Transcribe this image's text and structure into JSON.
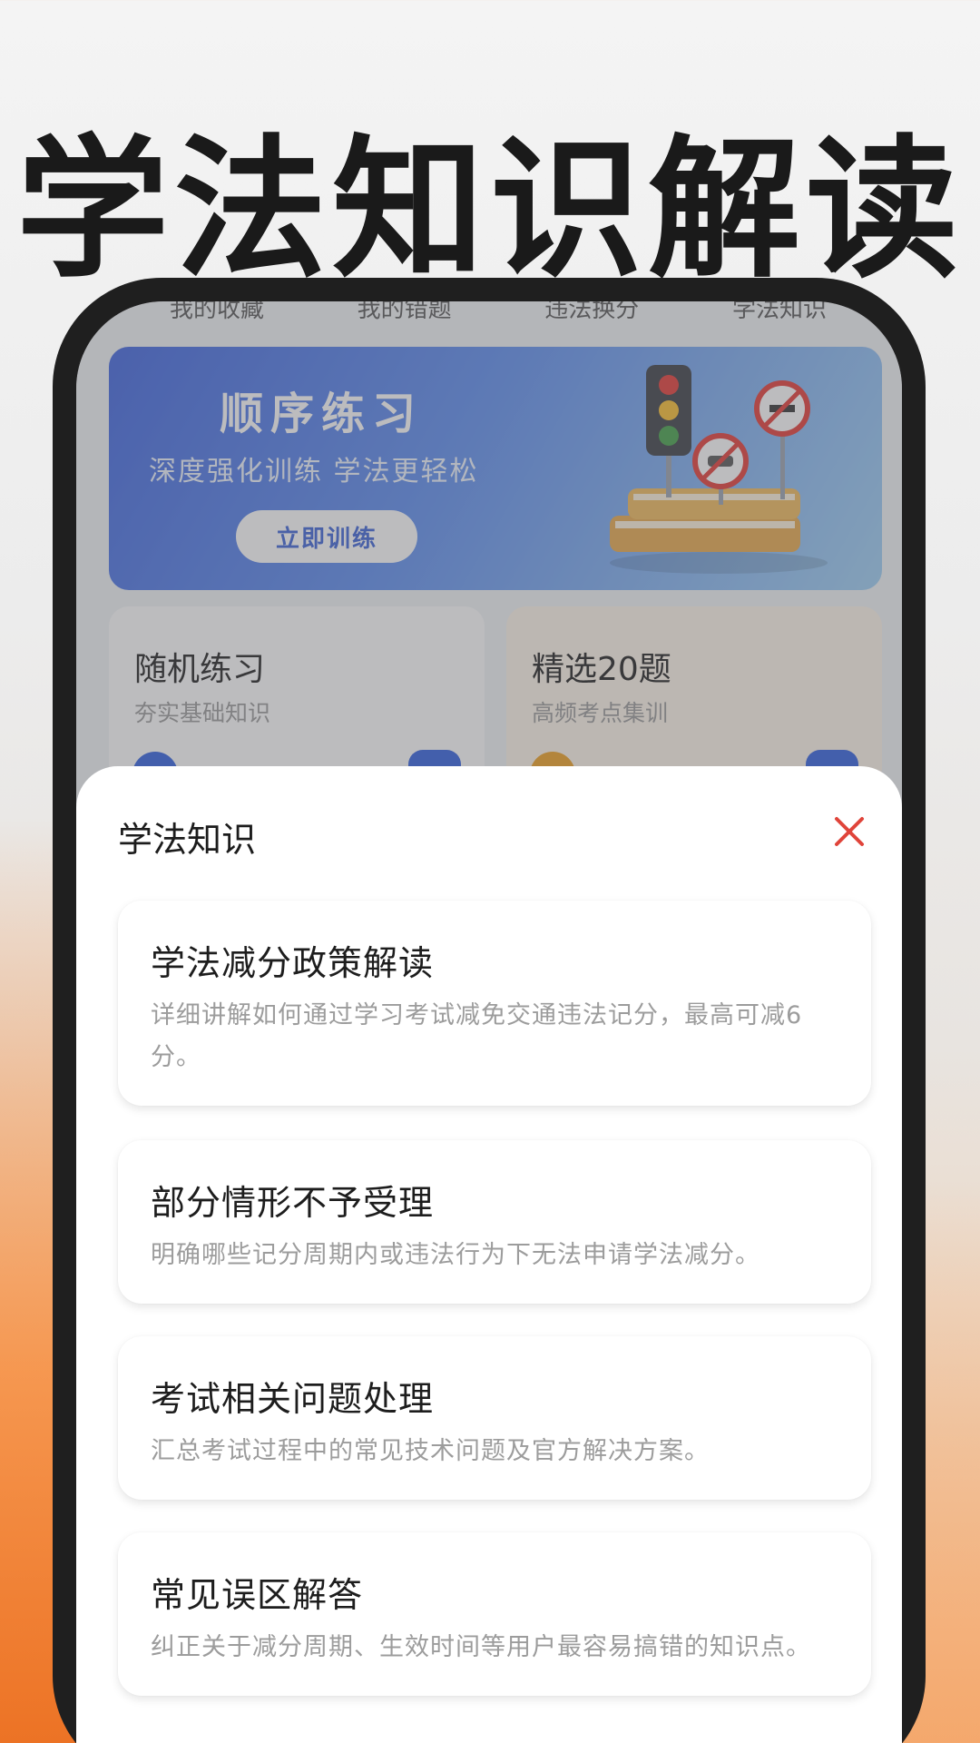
{
  "hero": {
    "title": "学法知识解读"
  },
  "app": {
    "top_tabs": [
      "我的收藏",
      "我的错题",
      "违法换分",
      "学法知识"
    ],
    "banner": {
      "title": "顺序练习",
      "subtitle": "深度强化训练 学法更轻松",
      "button_label": "立即训练"
    },
    "cards": [
      {
        "title": "随机练习",
        "subtitle": "夯实基础知识"
      },
      {
        "title": "精选20题",
        "subtitle": "高频考点集训"
      }
    ]
  },
  "sheet": {
    "title": "学法知识",
    "close_icon": "close-icon",
    "close_color": "#e0443a",
    "items": [
      {
        "title": "学法减分政策解读",
        "desc": "详细讲解如何通过学习考试减免交通违法记分，最高可减6分。"
      },
      {
        "title": "部分情形不予受理",
        "desc": "明确哪些记分周期内或违法行为下无法申请学法减分。"
      },
      {
        "title": "考试相关问题处理",
        "desc": "汇总考试过程中的常见技术问题及官方解决方案。"
      },
      {
        "title": "常见误区解答",
        "desc": "纠正关于减分周期、生效时间等用户最容易搞错的知识点。"
      }
    ]
  }
}
